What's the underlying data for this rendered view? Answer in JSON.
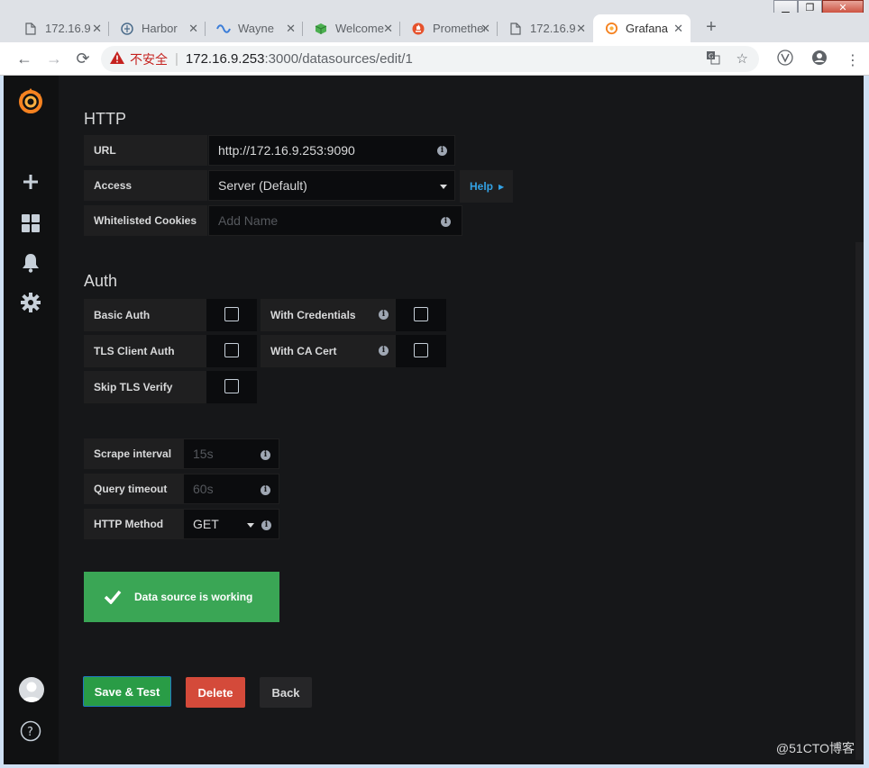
{
  "window": {
    "minimize": "▁",
    "restore": "❐",
    "close": "✕"
  },
  "tabs": [
    {
      "title": "172.16.9",
      "icon": "document-icon",
      "active": false
    },
    {
      "title": "Harbor",
      "icon": "harbor-icon",
      "active": false
    },
    {
      "title": "Wayne",
      "icon": "wayne-icon",
      "active": false
    },
    {
      "title": "Welcome",
      "icon": "cube-icon",
      "active": false
    },
    {
      "title": "Prometheus",
      "icon": "prometheus-icon",
      "active": false
    },
    {
      "title": "172.16.9",
      "icon": "document-icon",
      "active": false
    },
    {
      "title": "Grafana",
      "icon": "grafana-icon",
      "active": true
    }
  ],
  "toolbar": {
    "back": "←",
    "forward": "→",
    "reload": "⟳",
    "insecure_label": "不安全",
    "url_host": "172.16.9.253",
    "url_path": ":3000/datasources/edit/1"
  },
  "http": {
    "section_title": "HTTP",
    "url_label": "URL",
    "url_value": "http://172.16.9.253:9090",
    "access_label": "Access",
    "access_value": "Server (Default)",
    "help_label": "Help",
    "cookies_label": "Whitelisted Cookies",
    "cookies_placeholder": "Add Name"
  },
  "auth": {
    "section_title": "Auth",
    "basic_auth": "Basic Auth",
    "with_credentials": "With Credentials",
    "tls_client_auth": "TLS Client Auth",
    "with_ca_cert": "With CA Cert",
    "skip_tls_verify": "Skip TLS Verify"
  },
  "prometheus": {
    "scrape_interval_label": "Scrape interval",
    "scrape_interval_placeholder": "15s",
    "query_timeout_label": "Query timeout",
    "query_timeout_placeholder": "60s",
    "http_method_label": "HTTP Method",
    "http_method_value": "GET"
  },
  "status": {
    "message": "Data source is working"
  },
  "buttons": {
    "save_test": "Save & Test",
    "delete": "Delete",
    "back": "Back"
  },
  "watermark": "@51CTO博客",
  "colors": {
    "grafana_bg": "#161719",
    "success": "#3aa655",
    "danger": "#d44a3a",
    "link": "#33a2e5"
  }
}
